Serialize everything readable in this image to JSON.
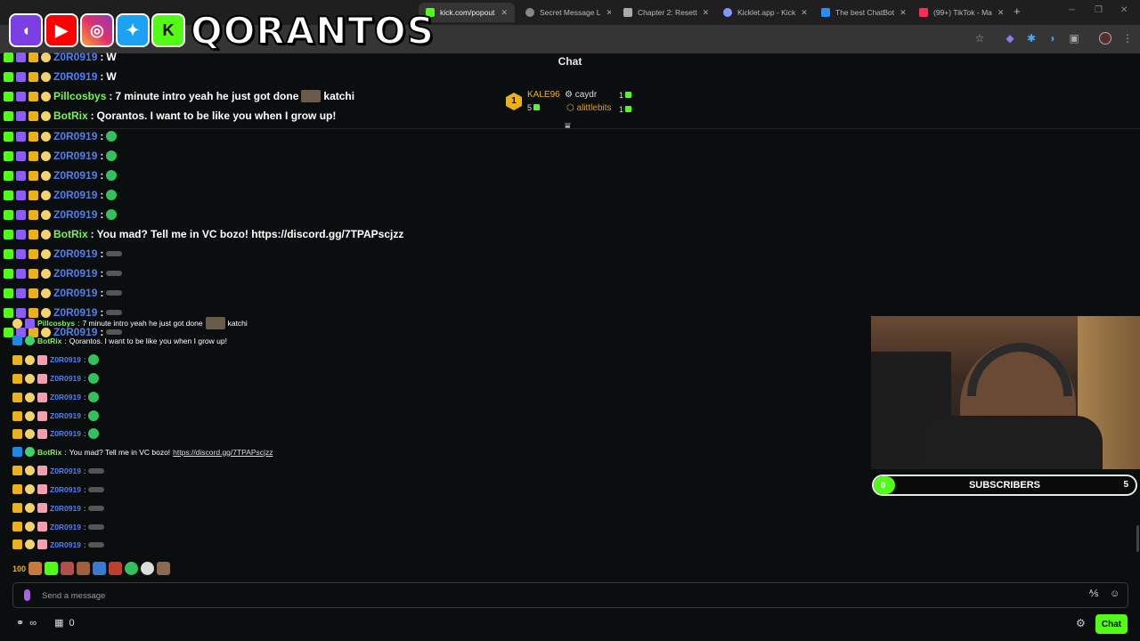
{
  "browser": {
    "tabs": [
      {
        "label": "kick.com/popout",
        "active": true,
        "color": "#53fc18"
      },
      {
        "label": "Secret Message L",
        "active": false,
        "color": "#888888"
      },
      {
        "label": "Chapter 2: Resett",
        "active": false,
        "color": "#aaaaaa"
      },
      {
        "label": "Kicklet.app - Kick",
        "active": false,
        "color": "#7b9cff"
      },
      {
        "label": "The best ChatBot",
        "active": false,
        "color": "#2a8cff"
      },
      {
        "label": "(99+) TikTok - Ma",
        "active": false,
        "color": "#ff2d55"
      }
    ],
    "new_tab": "+"
  },
  "overlay": {
    "brand_name": "QORANTOS",
    "logos": [
      "twitch-icon",
      "youtube-icon",
      "instagram-icon",
      "twitter-icon",
      "kick-icon"
    ]
  },
  "chat": {
    "title": "Chat",
    "top_gifters": [
      {
        "name": "KALE96",
        "count": "5",
        "color": "#e9b21a"
      },
      {
        "name": "caydr",
        "count": "1",
        "color": "#dddddd"
      },
      {
        "name": "alittlebits",
        "count": "1",
        "color": "#e39b2a"
      }
    ],
    "rows": [
      {
        "kind": "big",
        "user": "Z0R0919",
        "sep": ":",
        "text": "W",
        "emote": "w",
        "userColor": "blue"
      },
      {
        "kind": "big",
        "user": "Z0R0919",
        "sep": ":",
        "text": "W",
        "emote": "w",
        "userColor": "blue"
      },
      {
        "kind": "big",
        "user": "Pillcosbys",
        "sep": ":",
        "text": "7 minute intro yeah he just got done",
        "tail": "katchi",
        "userColor": "green"
      },
      {
        "kind": "big",
        "user": "BotRix",
        "sep": ":",
        "text": "Qorantos. I want to be like you when I grow up!",
        "userColor": "green"
      },
      {
        "kind": "big",
        "user": "Z0R0919",
        "sep": ":",
        "text": "",
        "emote": "green",
        "userColor": "blue"
      },
      {
        "kind": "big",
        "user": "Z0R0919",
        "sep": ":",
        "text": "",
        "emote": "green",
        "userColor": "blue"
      },
      {
        "kind": "big",
        "user": "Z0R0919",
        "sep": ":",
        "text": "",
        "emote": "green",
        "userColor": "blue"
      },
      {
        "kind": "big",
        "user": "Z0R0919",
        "sep": ":",
        "text": "",
        "emote": "green",
        "userColor": "blue"
      },
      {
        "kind": "big",
        "user": "Z0R0919",
        "sep": ":",
        "text": "",
        "emote": "green",
        "userColor": "blue"
      },
      {
        "kind": "big",
        "user": "BotRix",
        "sep": ":",
        "text": "You mad? Tell me in VC bozo! https://discord.gg/7TPAPscjzz",
        "userColor": "green"
      },
      {
        "kind": "big",
        "user": "Z0R0919",
        "sep": ":",
        "text": "",
        "emote": "dark",
        "userColor": "blue"
      },
      {
        "kind": "big",
        "user": "Z0R0919",
        "sep": ":",
        "text": "",
        "emote": "dark",
        "userColor": "blue"
      },
      {
        "kind": "big",
        "user": "Z0R0919",
        "sep": ":",
        "text": "",
        "emote": "dark",
        "userColor": "blue"
      },
      {
        "kind": "big",
        "user": "Z0R0919",
        "sep": ":",
        "text": "",
        "emote": "dark",
        "userColor": "blue"
      },
      {
        "kind": "big",
        "user": "Z0R0919",
        "sep": ":",
        "text": "",
        "emote": "dark",
        "userColor": "blue"
      }
    ],
    "small_rows": [
      {
        "user": "Pillcosbys",
        "text": "7 minute intro yeah he just got done",
        "tail": "katchi",
        "bot": false,
        "userColor": "green"
      },
      {
        "user": "BotRix",
        "text": "Qorantos. I want to be like you when I grow up!",
        "bot": true,
        "userColor": "green"
      },
      {
        "user": "Z0R0919",
        "text": "",
        "emote": "green",
        "userColor": "blue"
      },
      {
        "user": "Z0R0919",
        "text": "",
        "emote": "green",
        "userColor": "blue"
      },
      {
        "user": "Z0R0919",
        "text": "",
        "emote": "green",
        "userColor": "blue"
      },
      {
        "user": "Z0R0919",
        "text": "",
        "emote": "green",
        "userColor": "blue"
      },
      {
        "user": "Z0R0919",
        "text": "",
        "emote": "green",
        "userColor": "blue"
      },
      {
        "user": "BotRix",
        "text": "You mad? Tell me in VC bozo!",
        "link": "https://discord.gg/7TPAPscjzz",
        "bot": true,
        "userColor": "green"
      },
      {
        "user": "Z0R0919",
        "text": "",
        "emote": "dark",
        "userColor": "blue"
      },
      {
        "user": "Z0R0919",
        "text": "",
        "emote": "dark",
        "userColor": "blue"
      },
      {
        "user": "Z0R0919",
        "text": "",
        "emote": "dark",
        "userColor": "blue"
      },
      {
        "user": "Z0R0919",
        "text": "",
        "emote": "dark",
        "userColor": "blue"
      },
      {
        "user": "Z0R0919",
        "text": "",
        "emote": "dark",
        "userColor": "blue"
      }
    ]
  },
  "subscribers": {
    "label": "SUBSCRIBERS",
    "current": "0",
    "goal": "5",
    "progress": 0.08
  },
  "input": {
    "placeholder": "Send a message",
    "send_label": "Chat",
    "bottom_count": "0"
  },
  "colors": {
    "kick_green": "#53fc18",
    "user_blue": "#4f7ff0",
    "user_green": "#7bf05a",
    "background": "#0b0e0f"
  }
}
